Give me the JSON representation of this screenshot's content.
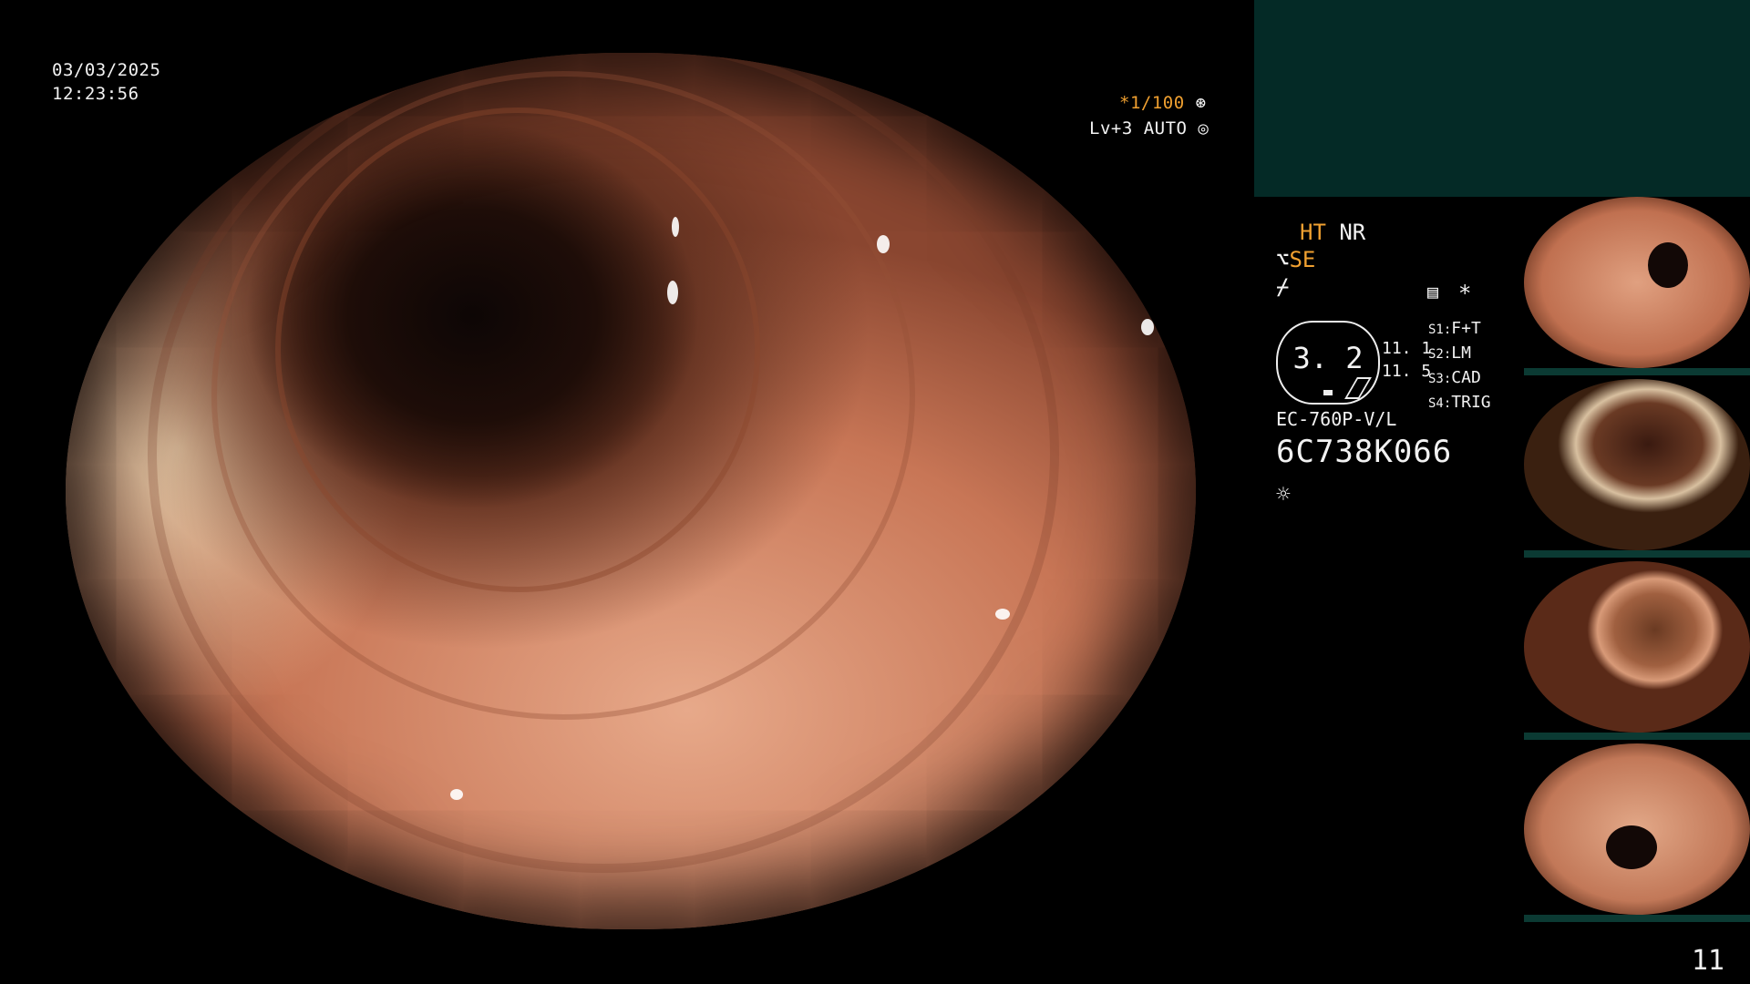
{
  "overlay": {
    "date": "03/03/2025",
    "time": "12:23:56",
    "shutter": "*1/100",
    "level": "Lv+3 AUTO"
  },
  "status": {
    "ht": "HT",
    "nr": "NR",
    "se": "SE",
    "gauge_value": "3. 2",
    "side_values": [
      "11. 1",
      "11. 5"
    ],
    "switches": [
      {
        "key": "S1:",
        "value": "F+T"
      },
      {
        "key": "S2:",
        "value": "LM"
      },
      {
        "key": "S3:",
        "value": "CAD"
      },
      {
        "key": "S4:",
        "value": "TRIG"
      }
    ],
    "model": "EC-760P-V/L",
    "serial": "6C738K066",
    "asterisk": "*"
  },
  "icons": [
    "shutter-icon",
    "auto-iris-icon",
    "hose-icon",
    "lightning-icon",
    "menu-icon",
    "light-icon"
  ],
  "colors": {
    "accent": "#f0a030",
    "panel": "#042a26",
    "text": "#f2f2f2"
  },
  "thumbnail_count": 4,
  "page_number": "11"
}
